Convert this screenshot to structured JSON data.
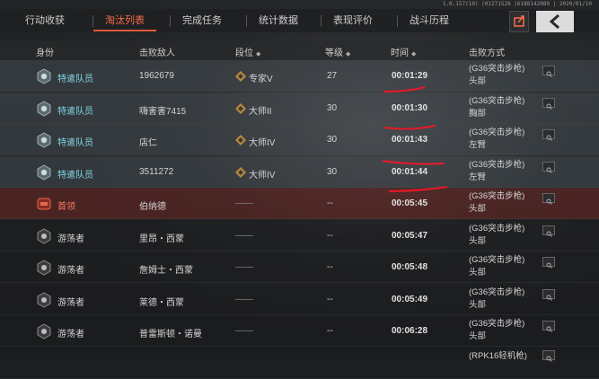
{
  "version": "1.0.157(10) |01271526 |6188142089 | 2020/01/10",
  "tabs": [
    {
      "label": "行动收获",
      "active": false
    },
    {
      "label": "淘汰列表",
      "active": true
    },
    {
      "label": "完成任务",
      "active": false
    },
    {
      "label": "统计数据",
      "active": false
    },
    {
      "label": "表现评价",
      "active": false
    },
    {
      "label": "战斗历程",
      "active": false
    }
  ],
  "buttons": {
    "export_icon": "export-icon",
    "back_icon": "chevron-left-icon"
  },
  "columns": {
    "identity": "身份",
    "killed": "击败敌人",
    "rank": "段位",
    "level": "等级",
    "time": "时间",
    "method": "击败方式"
  },
  "rows": [
    {
      "type": "agent",
      "identity": "特遣队员",
      "enemy": "1962679",
      "rank": "专家V",
      "level": "27",
      "time": "00:01:29",
      "method1": "(G36突击步枪)",
      "method2": "头部"
    },
    {
      "type": "agent",
      "identity": "特遣队员",
      "enemy": "嗨害害7415",
      "rank": "大师II",
      "level": "30",
      "time": "00:01:30",
      "method1": "(G36突击步枪)",
      "method2": "胸部"
    },
    {
      "type": "agent",
      "identity": "特遣队员",
      "enemy": "店仁",
      "rank": "大师IV",
      "level": "30",
      "time": "00:01:43",
      "method1": "(G36突击步枪)",
      "method2": "左臂"
    },
    {
      "type": "agent",
      "identity": "特遣队员",
      "enemy": "3511272",
      "rank": "大师IV",
      "level": "30",
      "time": "00:01:44",
      "method1": "(G36突击步枪)",
      "method2": "左臂"
    },
    {
      "type": "boss",
      "identity": "首领",
      "enemy": "伯纳德",
      "rank": "——",
      "level": "--",
      "time": "00:05:45",
      "method1": "(G36突击步枪)",
      "method2": "头部"
    },
    {
      "type": "normal",
      "identity": "游荡者",
      "enemy": "里昂・西蒙",
      "rank": "——",
      "level": "--",
      "time": "00:05:47",
      "method1": "(G36突击步枪)",
      "method2": "头部"
    },
    {
      "type": "normal",
      "identity": "游荡者",
      "enemy": "詹姆士・西蒙",
      "rank": "——",
      "level": "--",
      "time": "00:05:48",
      "method1": "(G36突击步枪)",
      "method2": "头部"
    },
    {
      "type": "normal",
      "identity": "游荡者",
      "enemy": "莱德・西蒙",
      "rank": "——",
      "level": "--",
      "time": "00:05:49",
      "method1": "(G36突击步枪)",
      "method2": "头部"
    },
    {
      "type": "normal",
      "identity": "游荡者",
      "enemy": "普雷斯顿・诺曼",
      "rank": "——",
      "level": "--",
      "time": "00:06:28",
      "method1": "(G36突击步枪)",
      "method2": "头部"
    },
    {
      "type": "normal",
      "identity": "",
      "enemy": "",
      "rank": "",
      "level": "",
      "time": "",
      "method1": "(RPK16轻机枪)",
      "method2": ""
    }
  ]
}
